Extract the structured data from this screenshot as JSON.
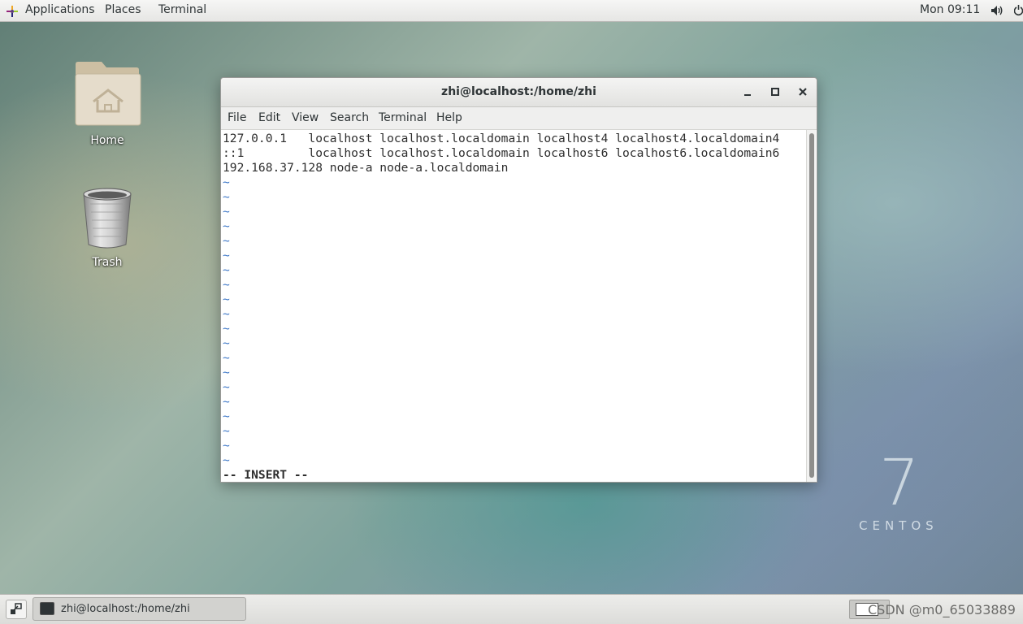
{
  "top_panel": {
    "applications_label": "Applications",
    "places_label": "Places",
    "terminal_label": "Terminal",
    "clock": "Mon 09:11"
  },
  "desktop": {
    "home_label": "Home",
    "trash_label": "Trash",
    "centos_version": "7",
    "centos_name": "CENTOS"
  },
  "terminal": {
    "title": "zhi@localhost:/home/zhi",
    "menu": [
      "File",
      "Edit",
      "View",
      "Search",
      "Terminal",
      "Help"
    ],
    "lines": [
      "127.0.0.1   localhost localhost.localdomain localhost4 localhost4.localdomain4",
      "::1         localhost localhost.localdomain localhost6 localhost6.localdomain6",
      "192.168.37.128 node-a node-a.localdomain"
    ],
    "tilde": "~",
    "tilde_count": 20,
    "status": "-- INSERT --"
  },
  "bottom_panel": {
    "task_label": "zhi@localhost:/home/zhi",
    "watermark": "CSDN @m0_65033889"
  },
  "colors": {
    "vim_tilde": "#3f78c8",
    "panel_bg": "#ececea"
  }
}
